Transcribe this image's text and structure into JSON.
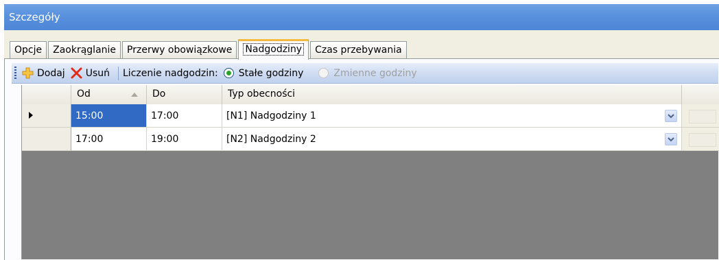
{
  "window": {
    "title": "Szczegóły"
  },
  "tabs": [
    {
      "label": "Opcje"
    },
    {
      "label": "Zaokrąglanie"
    },
    {
      "label": "Przerwy obowiązkowe"
    },
    {
      "label": "Nadgodziny",
      "active": true
    },
    {
      "label": "Czas przebywania"
    }
  ],
  "toolbar": {
    "add_label": "Dodaj",
    "add_icon": "plus-icon",
    "delete_label": "Usuń",
    "delete_icon": "red-x-icon",
    "counting_label": "Liczenie nadgodzin:",
    "fixed_hours_label": "Stałe godziny",
    "fixed_hours_selected": true,
    "variable_hours_label": "Zmienne godziny",
    "variable_hours_enabled": false
  },
  "grid": {
    "columns": {
      "from": "Od",
      "to": "Do",
      "type": "Typ obecności"
    },
    "rows": [
      {
        "from": "15:00",
        "to": "17:00",
        "type": "[N1]  Nadgodziny 1",
        "current": true
      },
      {
        "from": "17:00",
        "to": "19:00",
        "type": "[N2]  Nadgodziny 2",
        "current": false
      }
    ]
  },
  "colors": {
    "titlebar": "#5a92de",
    "selection": "#316ac5",
    "active_tab_accent": "#f4b940",
    "grid_empty": "#808080"
  }
}
